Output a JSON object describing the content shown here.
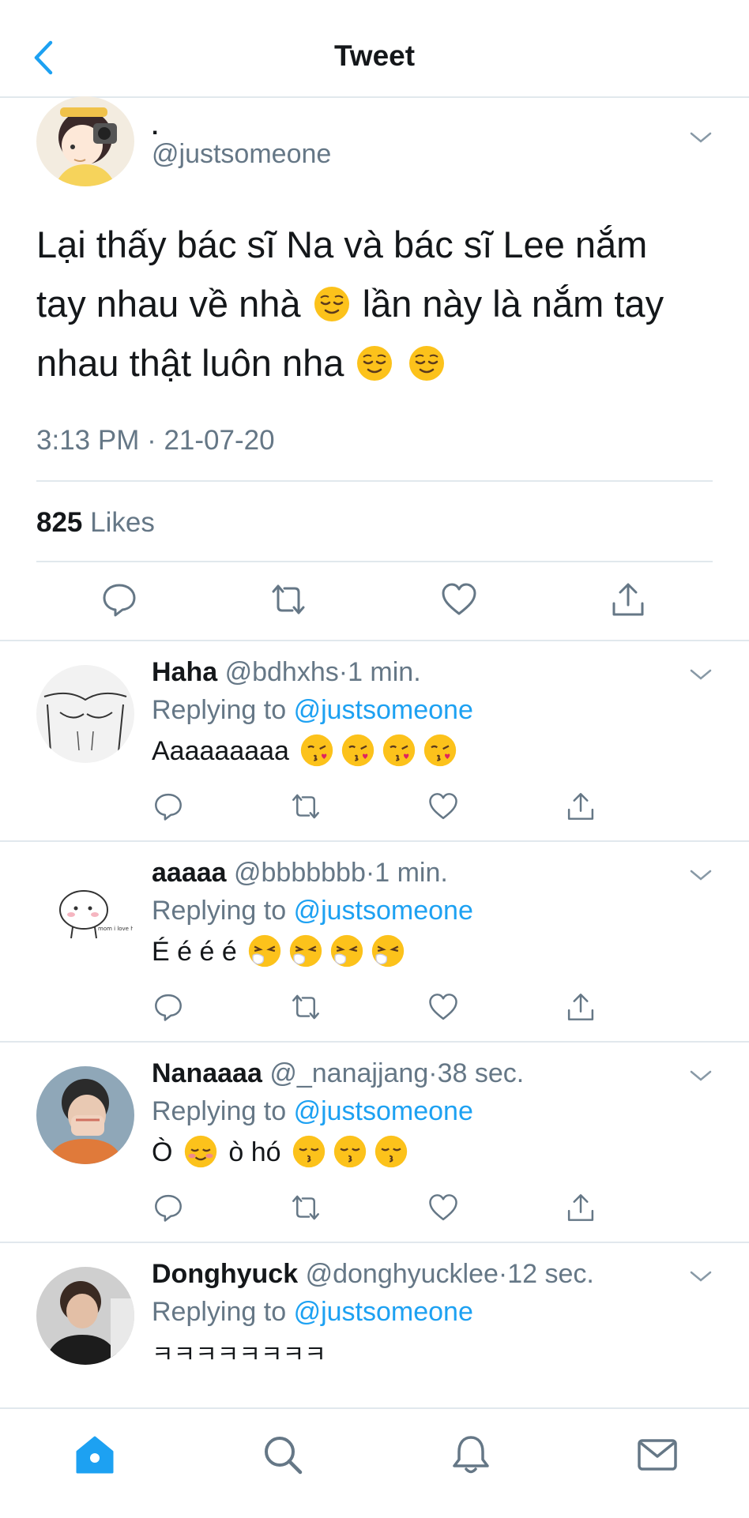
{
  "header": {
    "title": "Tweet",
    "back_icon": "chevron-left-icon"
  },
  "main_tweet": {
    "name": ".",
    "handle": "@justsomeone",
    "text_line1": "Lại thấy bác sĩ Na và bác sĩ Lee nắm",
    "text_line2a": "tay nhau về nhà",
    "text_line2b": "lần này là nắm tay",
    "text_line3": "nhau thật luôn nha",
    "timestamp": "3:13 PM · 21-07-20",
    "likes_count": "825",
    "likes_label": "Likes"
  },
  "replies": [
    {
      "name": "Haha",
      "handle": "@bdhxhs",
      "dot": "·",
      "time": "1 min.",
      "replying_prefix": "Replying to",
      "mention": "@justsomeone",
      "text": "Aaaaaaaaa",
      "emoji_type": "kiss-heart",
      "emoji_count": 4
    },
    {
      "name": "aaaaa",
      "handle": "@bbbbbbb",
      "dot": "·",
      "time": "1 min.",
      "replying_prefix": "Replying to",
      "mention": "@justsomeone",
      "text": "É é é é",
      "emoji_type": "sneezing",
      "emoji_count": 4
    },
    {
      "name": "Nanaaaa",
      "handle": "@_nanajjang",
      "dot": "·",
      "time": "38 sec.",
      "replying_prefix": "Replying to",
      "mention": "@justsomeone",
      "text_a": "Ò",
      "text_b": "ò hó",
      "emoji_type": "kissing",
      "emoji_count": 3
    },
    {
      "name": "Donghyuck",
      "handle": "@donghyucklee",
      "dot": "·",
      "time": "12 sec.",
      "replying_prefix": "Replying to",
      "mention": "@justsomeone",
      "text": "ㅋㅋㅋㅋㅋㅋㅋㅋ"
    }
  ],
  "colors": {
    "accent": "#1da1f2",
    "secondary_text": "#657786",
    "divider": "#e1e8ed",
    "home_active": "#1da1f2"
  },
  "bottom_nav": [
    "home-icon",
    "search-icon",
    "bell-icon",
    "mail-icon"
  ]
}
